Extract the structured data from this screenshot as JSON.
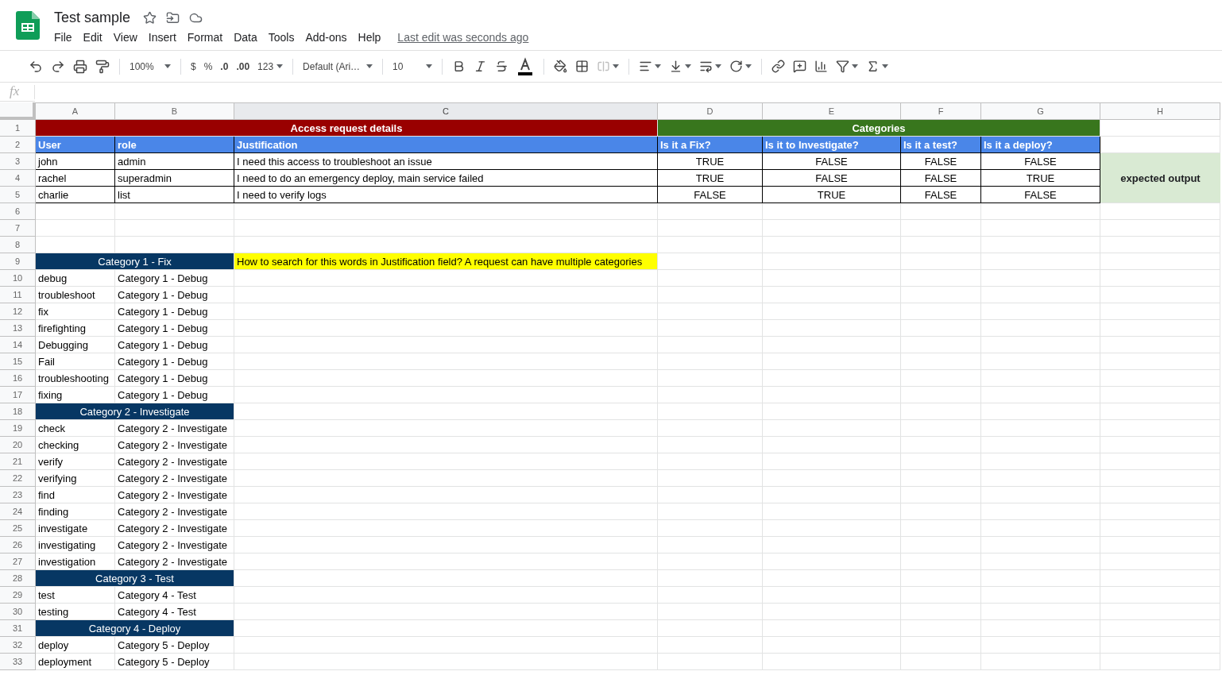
{
  "document": {
    "title": "Test sample",
    "last_edit": "Last edit was seconds ago"
  },
  "menu": [
    "File",
    "Edit",
    "View",
    "Insert",
    "Format",
    "Data",
    "Tools",
    "Add-ons",
    "Help"
  ],
  "toolbar": {
    "zoom": "100%",
    "currency": "$",
    "percent": "%",
    "decrease_decimal": ".0",
    "increase_decimal": ".00",
    "number_format": "123",
    "font": "Default (Ari…",
    "font_size": "10"
  },
  "formula_bar": {
    "label": "fx"
  },
  "columns": [
    {
      "label": "A",
      "selected": false
    },
    {
      "label": "B",
      "selected": false
    },
    {
      "label": "C",
      "selected": true
    },
    {
      "label": "D",
      "selected": false
    },
    {
      "label": "E",
      "selected": false
    },
    {
      "label": "F",
      "selected": false
    },
    {
      "label": "G",
      "selected": false
    },
    {
      "label": "H",
      "selected": false
    }
  ],
  "expected_output": "expected output",
  "rows": [
    {
      "num": "1",
      "kind": "sections",
      "sections": [
        {
          "text": "Access request details",
          "color": "#990000"
        },
        {
          "text": "Categories",
          "color": "#38761d"
        }
      ]
    },
    {
      "num": "2",
      "kind": "headers",
      "cells": [
        "User",
        "role",
        "Justification",
        "Is it a Fix?",
        "Is it to Investigate?",
        "Is it a test?",
        "Is it a deploy?"
      ]
    },
    {
      "num": "3",
      "kind": "data",
      "cells": [
        "john",
        "admin",
        "I need this access to troubleshoot an issue",
        "TRUE",
        "FALSE",
        "FALSE",
        "FALSE"
      ]
    },
    {
      "num": "4",
      "kind": "data",
      "cells": [
        "rachel",
        "superadmin",
        "I need to do an emergency deploy, main service failed",
        "TRUE",
        "FALSE",
        "FALSE",
        "TRUE"
      ]
    },
    {
      "num": "5",
      "kind": "data",
      "cells": [
        "charlie",
        "list",
        "I need to verify logs",
        "FALSE",
        "TRUE",
        "FALSE",
        "FALSE"
      ]
    },
    {
      "num": "6",
      "kind": "empty"
    },
    {
      "num": "7",
      "kind": "empty"
    },
    {
      "num": "8",
      "kind": "empty"
    },
    {
      "num": "9",
      "kind": "category",
      "text": "Category 1 - Fix",
      "note": "How to search for this words in Justification field? A request can have multiple categories"
    },
    {
      "num": "10",
      "kind": "term",
      "cells": [
        "debug",
        "Category 1 - Debug"
      ]
    },
    {
      "num": "11",
      "kind": "term",
      "cells": [
        "troubleshoot",
        "Category 1 - Debug"
      ]
    },
    {
      "num": "12",
      "kind": "term",
      "cells": [
        "fix",
        "Category 1 - Debug"
      ]
    },
    {
      "num": "13",
      "kind": "term",
      "cells": [
        "firefighting",
        "Category 1 - Debug"
      ]
    },
    {
      "num": "14",
      "kind": "term",
      "cells": [
        "Debugging",
        "Category 1 - Debug"
      ]
    },
    {
      "num": "15",
      "kind": "term",
      "cells": [
        "Fail",
        "Category 1 - Debug"
      ]
    },
    {
      "num": "16",
      "kind": "term",
      "cells": [
        "troubleshooting",
        "Category 1 - Debug"
      ]
    },
    {
      "num": "17",
      "kind": "term",
      "cells": [
        "fixing",
        "Category 1 - Debug"
      ]
    },
    {
      "num": "18",
      "kind": "category",
      "text": "Category 2 - Investigate"
    },
    {
      "num": "19",
      "kind": "term",
      "cells": [
        "check",
        "Category 2 - Investigate"
      ]
    },
    {
      "num": "20",
      "kind": "term",
      "cells": [
        "checking",
        "Category 2 - Investigate"
      ]
    },
    {
      "num": "21",
      "kind": "term",
      "cells": [
        "verify",
        "Category 2 - Investigate"
      ]
    },
    {
      "num": "22",
      "kind": "term",
      "cells": [
        "verifying",
        "Category 2 - Investigate"
      ]
    },
    {
      "num": "23",
      "kind": "term",
      "cells": [
        "find",
        "Category 2 - Investigate"
      ]
    },
    {
      "num": "24",
      "kind": "term",
      "cells": [
        "finding",
        "Category 2 - Investigate"
      ]
    },
    {
      "num": "25",
      "kind": "term",
      "cells": [
        "investigate",
        "Category 2 - Investigate"
      ]
    },
    {
      "num": "26",
      "kind": "term",
      "cells": [
        "investigating",
        "Category 2 - Investigate"
      ]
    },
    {
      "num": "27",
      "kind": "term",
      "cells": [
        "investigation",
        "Category 2 - Investigate"
      ]
    },
    {
      "num": "28",
      "kind": "category",
      "text": "Category 3 - Test"
    },
    {
      "num": "29",
      "kind": "term",
      "cells": [
        "test",
        "Category 4 - Test"
      ]
    },
    {
      "num": "30",
      "kind": "term",
      "cells": [
        "testing",
        "Category 4 - Test"
      ]
    },
    {
      "num": "31",
      "kind": "category",
      "text": "Category 4 - Deploy"
    },
    {
      "num": "32",
      "kind": "term",
      "cells": [
        "deploy",
        "Category 5 - Deploy"
      ]
    },
    {
      "num": "33",
      "kind": "term",
      "cells": [
        "deployment",
        "Category 5 - Deploy"
      ]
    }
  ]
}
